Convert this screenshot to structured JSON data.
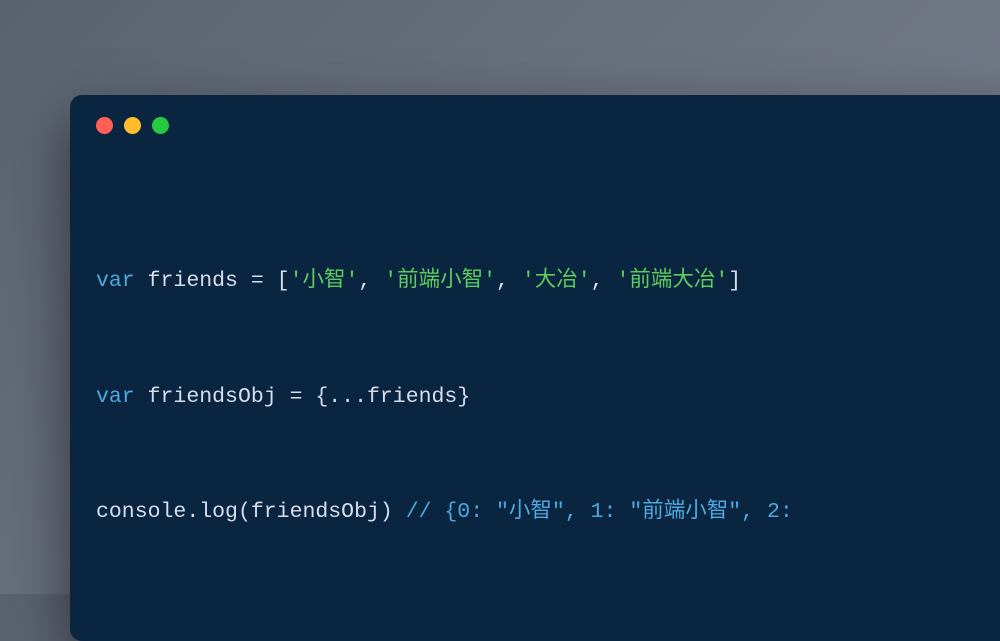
{
  "code": {
    "line1": {
      "var": "var",
      "sp1": " ",
      "name": "friends",
      "sp2": " ",
      "eq": "=",
      "sp3": " ",
      "lb": "[",
      "s1": "'小智'",
      "c1": ", ",
      "s2": "'前端小智'",
      "c2": ", ",
      "s3": "'大冶'",
      "c3": ", ",
      "s4": "'前端大冶'",
      "rb": "]"
    },
    "line2": {
      "var": "var",
      "sp1": " ",
      "name": "friendsObj",
      "sp2": " ",
      "eq": "=",
      "sp3": " ",
      "lb": "{",
      "spread": "...friends",
      "rb": "}"
    },
    "line3": {
      "console": "console",
      "dot": ".",
      "log": "log",
      "lp": "(",
      "arg": "friendsObj",
      "rp": ")",
      "sp": " ",
      "comment": "// {0: \"小智\", 1: \"前端小智\", 2:"
    }
  }
}
